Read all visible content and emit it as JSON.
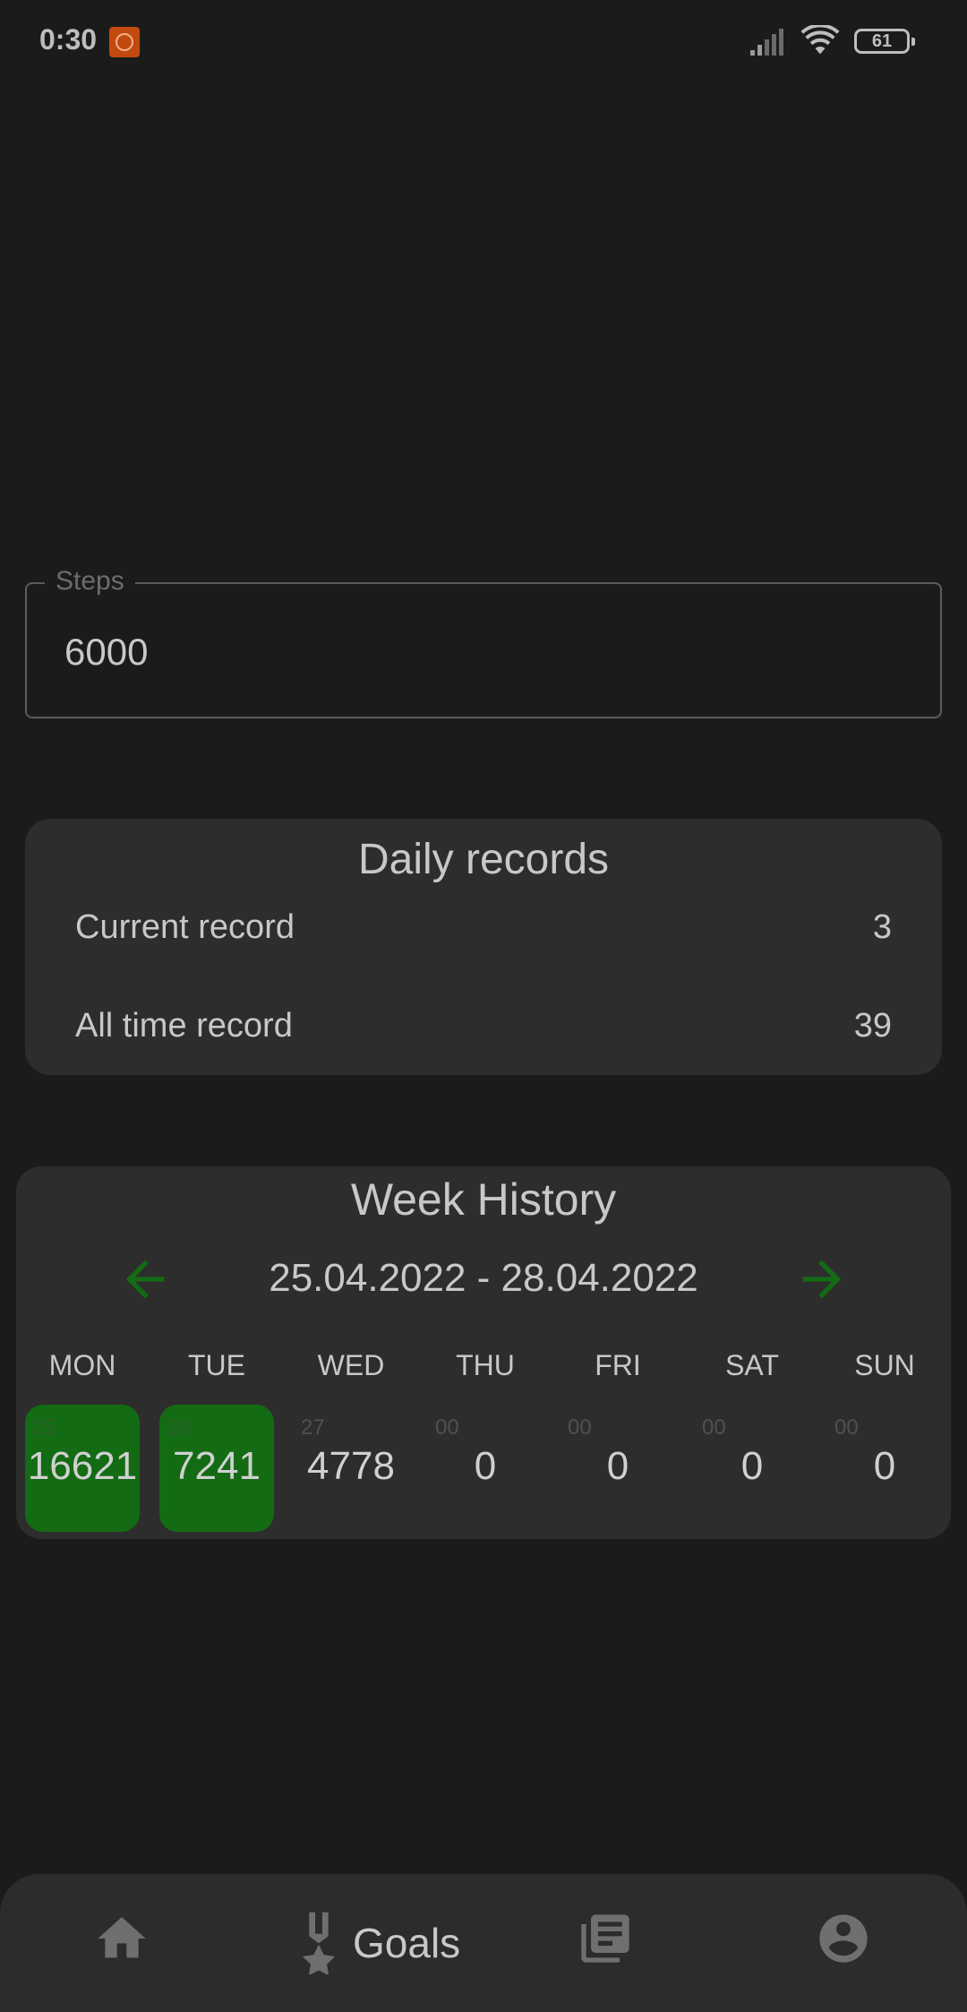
{
  "status_bar": {
    "time": "0:30",
    "battery": "61"
  },
  "steps_field": {
    "label": "Steps",
    "value": "6000"
  },
  "daily_records": {
    "title": "Daily records",
    "current_label": "Current record",
    "current_value": "3",
    "alltime_label": "All time record",
    "alltime_value": "39"
  },
  "week_history": {
    "title": "Week History",
    "range": "25.04.2022 - 28.04.2022",
    "accent_color": "#136b13",
    "days": [
      {
        "name": "MON",
        "num": "25",
        "steps": "16621",
        "goal_met": true
      },
      {
        "name": "TUE",
        "num": "26",
        "steps": "7241",
        "goal_met": true
      },
      {
        "name": "WED",
        "num": "27",
        "steps": "4778",
        "goal_met": false
      },
      {
        "name": "THU",
        "num": "00",
        "steps": "0",
        "goal_met": false
      },
      {
        "name": "FRI",
        "num": "00",
        "steps": "0",
        "goal_met": false
      },
      {
        "name": "SAT",
        "num": "00",
        "steps": "0",
        "goal_met": false
      },
      {
        "name": "SUN",
        "num": "00",
        "steps": "0",
        "goal_met": false
      }
    ]
  },
  "bottom_nav": {
    "items": [
      {
        "icon": "home-icon"
      },
      {
        "icon": "medal-icon",
        "label": "Goals",
        "active": true
      },
      {
        "icon": "news-icon"
      },
      {
        "icon": "account-icon"
      }
    ]
  }
}
